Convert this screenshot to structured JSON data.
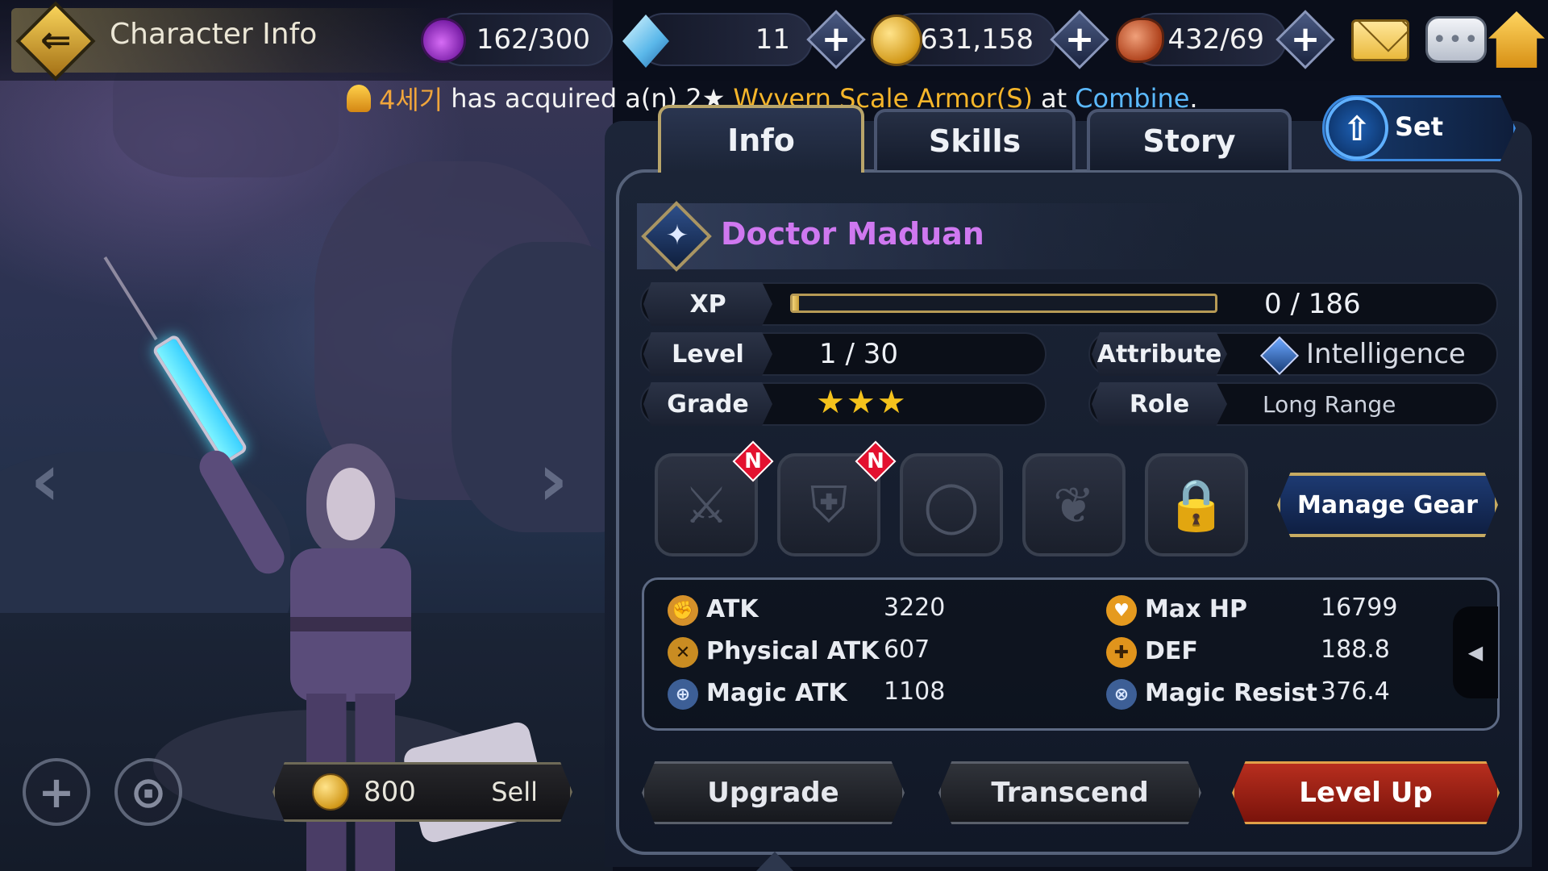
{
  "header": {
    "title": "Character Info",
    "resources": [
      {
        "icon": "stamina-potion-icon",
        "value": "162/300"
      },
      {
        "icon": "gem-icon",
        "value": "11"
      },
      {
        "icon": "gold-coin-icon",
        "value": "631,158"
      },
      {
        "icon": "meat-icon",
        "value": "432/69"
      }
    ]
  },
  "notice": {
    "user": "4세기",
    "text1": "has acquired a(n) 2★",
    "item": "Wyvern Scale Armor(S)",
    "text2": "at",
    "place": "Combine",
    "end": "."
  },
  "tabs": [
    "Info",
    "Skills",
    "Story"
  ],
  "set_button": {
    "label": "Set"
  },
  "character": {
    "name": "Doctor Maduan",
    "xp_label": "XP",
    "xp_value": "0 / 186",
    "xp_fraction": 0.0,
    "level_label": "Level",
    "level_value": "1 / 30",
    "grade_label": "Grade",
    "grade_stars": "★★★",
    "attribute_label": "Attribute",
    "attribute_value": "Intelligence",
    "role_label": "Role",
    "role_value": "Long Range"
  },
  "gear": {
    "slots": [
      {
        "icon": "sword-icon",
        "glyph": "⚔",
        "new": "N"
      },
      {
        "icon": "armor-icon",
        "glyph": "⛨",
        "new": "N"
      },
      {
        "icon": "ring-icon",
        "glyph": "◯",
        "new": ""
      },
      {
        "icon": "necklace-icon",
        "glyph": "❦",
        "new": ""
      },
      {
        "icon": "lock-icon",
        "glyph": "🔒",
        "new": ""
      }
    ],
    "manage_label": "Manage Gear"
  },
  "stats": {
    "left": [
      {
        "name": "ATK",
        "value": "3220"
      },
      {
        "name": "Physical ATK",
        "value": "607"
      },
      {
        "name": "Magic ATK",
        "value": "1108"
      }
    ],
    "right": [
      {
        "name": "Max HP",
        "value": "16799"
      },
      {
        "name": "DEF",
        "value": "188.8"
      },
      {
        "name": "Magic Resist",
        "value": "376.4"
      }
    ],
    "collapse_glyph": "◀"
  },
  "sell": {
    "price": "800",
    "label": "Sell"
  },
  "actions": {
    "upgrade": "Upgrade",
    "transcend": "Transcend",
    "level_up": "Level Up"
  },
  "colors": {
    "name_color": "#cf78f0",
    "notice_item": "#f5b52a",
    "notice_place": "#5bb9ff",
    "level_up_button": "#b72e1e",
    "new_badge": "#e3112f"
  }
}
